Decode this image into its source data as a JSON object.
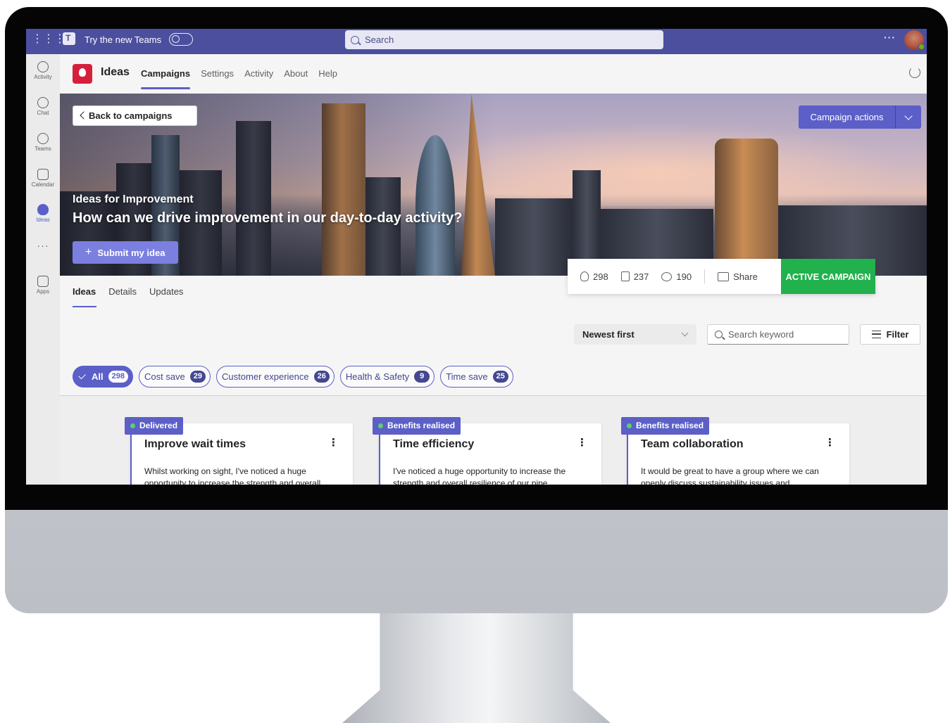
{
  "topbar": {
    "try_label": "Try the new Teams",
    "search_placeholder": "Search",
    "more_label": "···"
  },
  "rail": {
    "items": [
      {
        "label": "Activity",
        "icon": "bell-icon"
      },
      {
        "label": "Chat",
        "icon": "chat-icon"
      },
      {
        "label": "Teams",
        "icon": "teams-icon"
      },
      {
        "label": "Calendar",
        "icon": "calendar-icon"
      },
      {
        "label": "Ideas",
        "icon": "lightbulb-icon"
      },
      {
        "label": "Apps",
        "icon": "apps-icon"
      }
    ],
    "more_label": "···"
  },
  "app": {
    "name": "Ideas",
    "nav": [
      "Campaigns",
      "Settings",
      "Activity",
      "About",
      "Help"
    ]
  },
  "hero": {
    "back_label": "Back to campaigns",
    "subtitle": "Ideas for Improvement",
    "title": "How can we drive improvement in our day-to-day activity?",
    "submit_label": "Submit my idea",
    "campaign_actions_label": "Campaign actions"
  },
  "stats": {
    "ideas": "298",
    "likes": "237",
    "comments": "190",
    "share_label": "Share",
    "status": "ACTIVE CAMPAIGN",
    "status_color": "#21b14d"
  },
  "tabs": [
    "Ideas",
    "Details",
    "Updates"
  ],
  "toolbar": {
    "sort_value": "Newest first",
    "search_placeholder": "Search keyword",
    "filter_label": "Filter"
  },
  "chips": [
    {
      "label": "All",
      "count": "298"
    },
    {
      "label": "Cost save",
      "count": "29"
    },
    {
      "label": "Customer experience",
      "count": "26"
    },
    {
      "label": "Health & Safety",
      "count": "9"
    },
    {
      "label": "Time save",
      "count": "25"
    }
  ],
  "cards": [
    {
      "tag": "Delivered",
      "title": "Improve wait times",
      "body": "Whilst working on sight, I've noticed a huge opportunity to increase the strength and overall"
    },
    {
      "tag": "Benefits realised",
      "title": "Time efficiency",
      "body": "I've noticed a huge opportunity to increase the strength and overall resilience of our pipe"
    },
    {
      "tag": "Benefits realised",
      "title": "Team collaboration",
      "body": "It would be great to have a group where we can openly discuss sustainability issues and"
    }
  ],
  "colors": {
    "accent": "#5b5fc7",
    "topbar": "#4b4f9e",
    "brand_red": "#d61f3c"
  }
}
